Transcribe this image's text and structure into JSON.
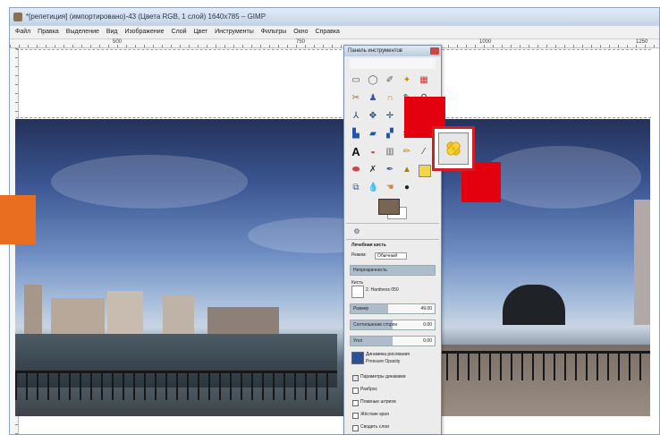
{
  "window": {
    "title": "*[репетиция] (импортировано)-43 (Цвета RGB, 1 слой) 1640x785 – GIMP"
  },
  "menu": {
    "items": [
      "Файл",
      "Правка",
      "Выделение",
      "Вид",
      "Изображение",
      "Слой",
      "Цвет",
      "Инструменты",
      "Фильтры",
      "Окно",
      "Справка"
    ]
  },
  "ruler": {
    "marks": [
      "500",
      "750",
      "1000",
      "1250"
    ]
  },
  "toolbox": {
    "title": "Панель инструментов",
    "tools": [
      "rect-select",
      "ellipse-select",
      "free-select",
      "fuzzy-select",
      "color-select",
      "scissors-select",
      "foreground-select",
      "paths",
      "color-picker",
      "zoom",
      "measure",
      "move",
      "align",
      "crop",
      "rotate",
      "scale",
      "shear",
      "perspective",
      "flip",
      "cage",
      "text",
      "bucket-fill",
      "blend",
      "pencil",
      "paintbrush",
      "eraser",
      "airbrush",
      "ink",
      "clone",
      "heal",
      "perspective-clone",
      "blur",
      "smudge",
      "dodge"
    ],
    "highlighted_tool": "heal"
  },
  "tool_options": {
    "tool_name": "Лечебная кисть",
    "mode_label": "Режим:",
    "mode_value": "Обычный",
    "opacity_label": "Непрозрачность",
    "brush_label": "Кисть",
    "brush_value": "2. Hardness 050",
    "size_label": "Размер",
    "size_value": "49.00",
    "size_fraction": 0.45,
    "aspect_label": "Соотношение сторон",
    "aspect_value": "0.00",
    "aspect_fraction": 0.5,
    "angle_label": "Угол",
    "angle_value": "0.00",
    "angle_fraction": 0.5,
    "dynamics_label": "Динамика рисования",
    "dynamics_value": "Pressure Opacity",
    "checks": [
      {
        "label": "Параметры динамики",
        "checked": true
      },
      {
        "label": "Разброс",
        "checked": false
      },
      {
        "label": "Плавные штрихи",
        "checked": false
      },
      {
        "label": "Жёсткие края",
        "checked": false
      },
      {
        "label": "Сводить слои",
        "checked": false
      }
    ]
  },
  "colors": {
    "foreground": "#7a6452",
    "background": "#ffffff",
    "highlight_red": "#e3000f",
    "tab_orange": "#ea6e1f"
  }
}
